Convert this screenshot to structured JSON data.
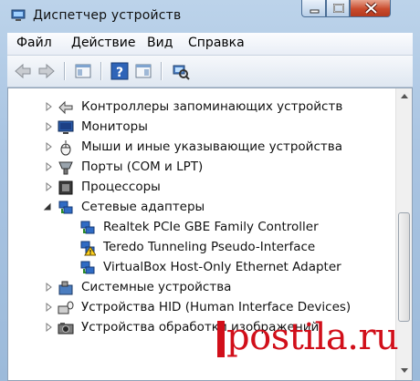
{
  "window": {
    "title": "Диспетчер устройств",
    "icon": "device-manager-icon"
  },
  "menu": {
    "items": [
      {
        "label": "Файл"
      },
      {
        "label": "Действие"
      },
      {
        "label": "Вид"
      },
      {
        "label": "Справка"
      }
    ]
  },
  "toolbar": {
    "buttons": [
      "back-arrow-icon",
      "forward-arrow-icon",
      "properties-pane-icon",
      "help-icon",
      "details-pane-icon",
      "scan-hardware-icon"
    ]
  },
  "tree": {
    "rows": [
      {
        "label": "Контроллеры запоминающих устройств",
        "icon": "storage-controller-icon",
        "expander": "collapsed"
      },
      {
        "label": "Мониторы",
        "icon": "monitor-icon",
        "expander": "collapsed"
      },
      {
        "label": "Мыши и иные указывающие устройства",
        "icon": "mouse-icon",
        "expander": "collapsed"
      },
      {
        "label": "Порты (COM и LPT)",
        "icon": "port-icon",
        "expander": "collapsed"
      },
      {
        "label": "Процессоры",
        "icon": "processor-icon",
        "expander": "collapsed"
      },
      {
        "label": "Сетевые адаптеры",
        "icon": "network-adapter-icon",
        "expander": "expanded"
      },
      {
        "label": "Realtek PCIe GBE Family Controller",
        "icon": "network-adapter-icon",
        "child": true
      },
      {
        "label": "Teredo Tunneling Pseudo-Interface",
        "icon": "network-adapter-warning-icon",
        "child": true,
        "warning": true
      },
      {
        "label": "VirtualBox Host-Only Ethernet Adapter",
        "icon": "network-adapter-icon",
        "child": true
      },
      {
        "label": "Системные устройства",
        "icon": "system-device-icon",
        "expander": "collapsed"
      },
      {
        "label": "Устройства HID (Human Interface Devices)",
        "icon": "hid-icon",
        "expander": "collapsed"
      },
      {
        "label": "Устройства обработки изображений",
        "icon": "imaging-device-icon",
        "expander": "collapsed"
      }
    ]
  },
  "watermark": {
    "text": "postila.ru",
    "color": "#d10f1a"
  }
}
